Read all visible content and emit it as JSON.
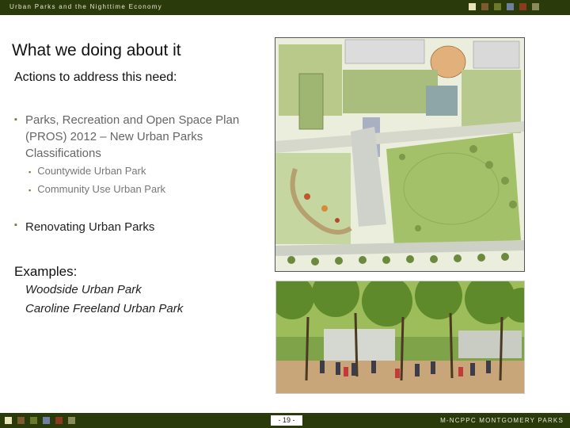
{
  "header": {
    "title": "Urban Parks and the Nighttime Economy",
    "square_colors": [
      "#e9e4b8",
      "#7a5a2e",
      "#6b7a2a",
      "#6e7fa0",
      "#8b3a1e",
      "#8a8a5a"
    ]
  },
  "slide": {
    "heading": "What we doing about it",
    "subheading": "Actions to address this need:",
    "bullets": [
      {
        "text": "Parks, Recreation and Open Space Plan (PROS) 2012 – New Urban Parks Classifications"
      },
      {
        "text": "Renovating Urban Parks"
      }
    ],
    "sub_bullets": [
      "Countywide Urban Park",
      "Community Use Urban Park"
    ],
    "examples_label": "Examples:",
    "examples": [
      "Woodside Urban Park",
      "Caroline Freeland Urban Park"
    ],
    "bullet_glyph": "▪"
  },
  "images": {
    "plan_label": "site-plan-drawing",
    "photo_label": "park-photo"
  },
  "footer": {
    "page": "- 19 -",
    "brand": "M-NCPPC MONTGOMERY PARKS",
    "square_colors": [
      "#e9e4b8",
      "#7a5a2e",
      "#6b7a2a",
      "#6e7fa0",
      "#8b3a1e",
      "#8a8a5a"
    ]
  }
}
